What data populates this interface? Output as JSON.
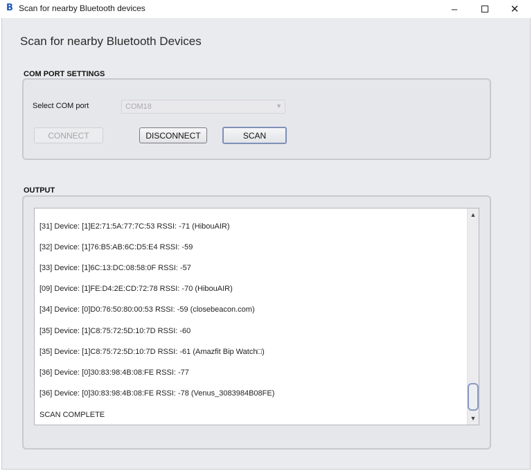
{
  "window": {
    "app_icon": "B",
    "title": "Scan for nearby Bluetooth devices",
    "minimize": "–",
    "close": "✕"
  },
  "heading": "Scan for nearby Bluetooth Devices",
  "com_port": {
    "section_label": "COM PORT SETTINGS",
    "select_label": "Select COM port",
    "selected_port": "COM18",
    "connect_label": "CONNECT",
    "disconnect_label": "DISCONNECT",
    "scan_label": "SCAN"
  },
  "output": {
    "section_label": "OUTPUT",
    "lines": [
      "[31] Device: [1]E2:71:5A:77:7C:53  RSSI: -71 (HibouAIR)",
      "[32] Device: [1]76:B5:AB:6C:D5:E4  RSSI: -59",
      "[33] Device: [1]6C:13:DC:08:58:0F  RSSI: -57",
      "[09] Device: [1]FE:D4:2E:CD:72:78  RSSI: -70 (HibouAIR)",
      "[34] Device: [0]D0:76:50:80:00:53  RSSI: -59 (closebeacon.com)",
      "[35] Device: [1]C8:75:72:5D:10:7D  RSSI: -60",
      "[35] Device: [1]C8:75:72:5D:10:7D  RSSI: -61 (Amazfit Bip Watch□)",
      "[36] Device: [0]30:83:98:4B:08:FE  RSSI: -77",
      "[36] Device: [0]30:83:98:4B:08:FE  RSSI: -78 (Venus_3083984B08FE)",
      "SCAN COMPLETE"
    ]
  },
  "icons": {
    "app": "bluetooth-app-icon",
    "minimize": "minimize-icon",
    "maximize": "maximize-icon",
    "close": "close-icon",
    "dropdown": "chevron-down-icon",
    "scroll_up": "arrow-up-icon",
    "scroll_down": "arrow-down-icon"
  }
}
